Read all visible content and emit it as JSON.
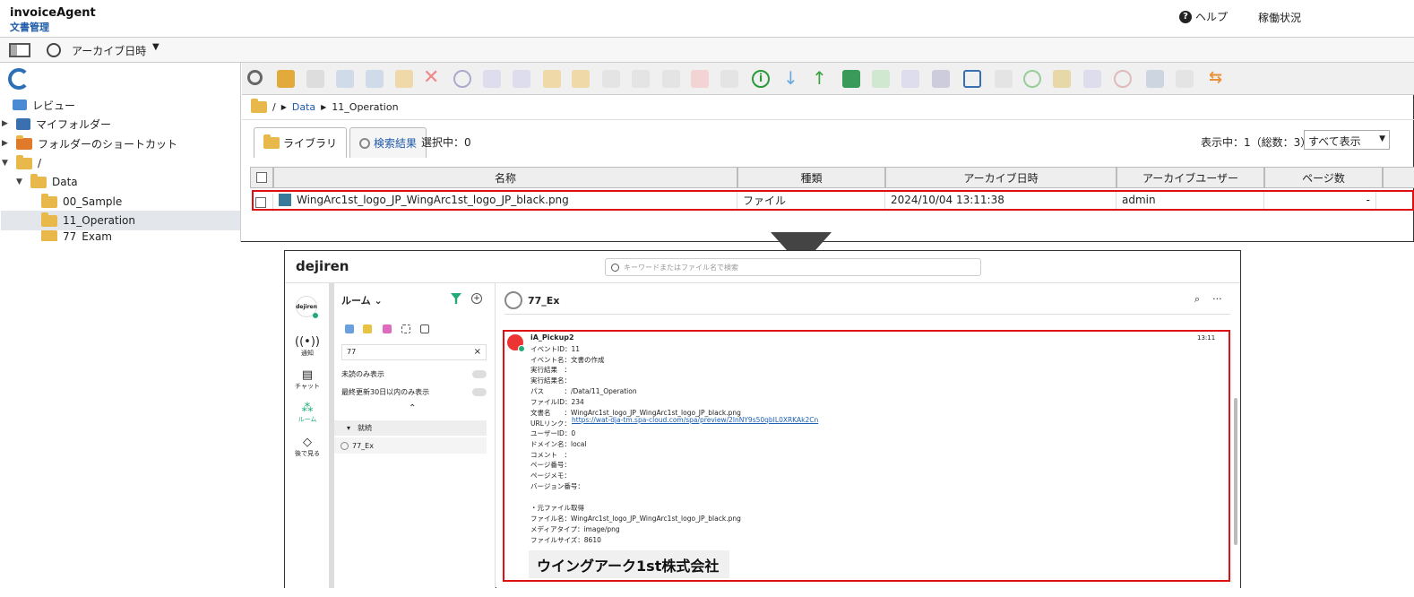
{
  "app": {
    "brand_line1": "invoiceAgent",
    "brand_line2": "文書管理",
    "help_label": "ヘルプ",
    "status_label": "稼働状況",
    "archive_label": "アーカイブ日時",
    "archive_dropdown": "▼"
  },
  "tree": [
    {
      "label": "レビュー",
      "tri": "",
      "icon": "review"
    },
    {
      "label": "マイフォルダー",
      "tri": "▶",
      "icon": "user-folder"
    },
    {
      "label": "フォルダーのショートカット",
      "tri": "▶",
      "icon": "shortcut-folder"
    },
    {
      "label": "/",
      "tri": "▼",
      "icon": "folder"
    },
    {
      "label": "Data",
      "tri": "▼",
      "icon": "folder"
    },
    {
      "label": "00_Sample",
      "tri": "",
      "icon": "folder"
    },
    {
      "label": "11_Operation",
      "tri": "",
      "icon": "folder"
    },
    {
      "label": "77_Exam",
      "tri": "",
      "icon": "folder"
    }
  ],
  "breadcrumb": [
    "/",
    "Data",
    "11_Operation"
  ],
  "tabs": [
    "ライブラリ",
    "検索結果"
  ],
  "selection": "選択中：0",
  "display_count": "表示中：1（総数：3）",
  "display_filter": "すべて表示",
  "table": {
    "headers": [
      "名称",
      "種類",
      "アーカイブ日時",
      "アーカイブユーザー",
      "ページ数"
    ],
    "rows": [
      {
        "name": "WingArc1st_logo_JP_WingArc1st_logo_JP_black.png",
        "type": "ファイル",
        "date": "2024/10/04 13:11:38",
        "user": "admin",
        "pages": "-"
      }
    ]
  },
  "dejiren": {
    "logo": "dejiren",
    "search_placeholder": "キーワードまたはファイル名で検索",
    "nav": [
      {
        "label": "通知",
        "glyph": "((•))"
      },
      {
        "label": "チャット",
        "glyph": "▤"
      },
      {
        "label": "ルーム",
        "glyph": "⁂"
      },
      {
        "label": "後で見る",
        "glyph": "◇"
      }
    ],
    "avatar_text": "dejiren",
    "room_header": "ルーム ⌄",
    "search_value": "77",
    "toggle_unread": "未読のみ表示",
    "toggle_recent": "最終更新30日以内のみ表示",
    "category": "▾　就続",
    "room_item": "77_Ex",
    "channel_title": "77_Ex",
    "message": {
      "user": "iA_Pickup2",
      "time": "13:11",
      "lines": [
        "イベントID：11",
        "イベント名：文書の作成",
        "実行結果　：",
        "実行結果名：",
        "パス　　　：/Data/11_Operation",
        "ファイルID：234",
        "文書名　　：WingArc1st_logo_JP_WingArc1st_logo_JP_black.png",
        "URLリンク：",
        "ユーザーID：0",
        "ドメイン名：local",
        "コメント　：",
        "ページ番号：",
        "ページメモ：",
        "バージョン番号：",
        "",
        "・元ファイル取得",
        "ファイル名：WingArc1st_logo_JP_WingArc1st_logo_JP_black.png",
        "メディアタイプ：image/png",
        "ファイルサイズ：8610"
      ],
      "url": "https://wat-dja-tm.spa-cloud.com/spa/preview/2lnNY9s50qbIL0XRKAk2Cn",
      "image_text": "ウイングアーク1st株式会社"
    }
  },
  "colors": {
    "accent": "#d11111",
    "brand": "#1e5aa8",
    "green": "#22aa77"
  }
}
